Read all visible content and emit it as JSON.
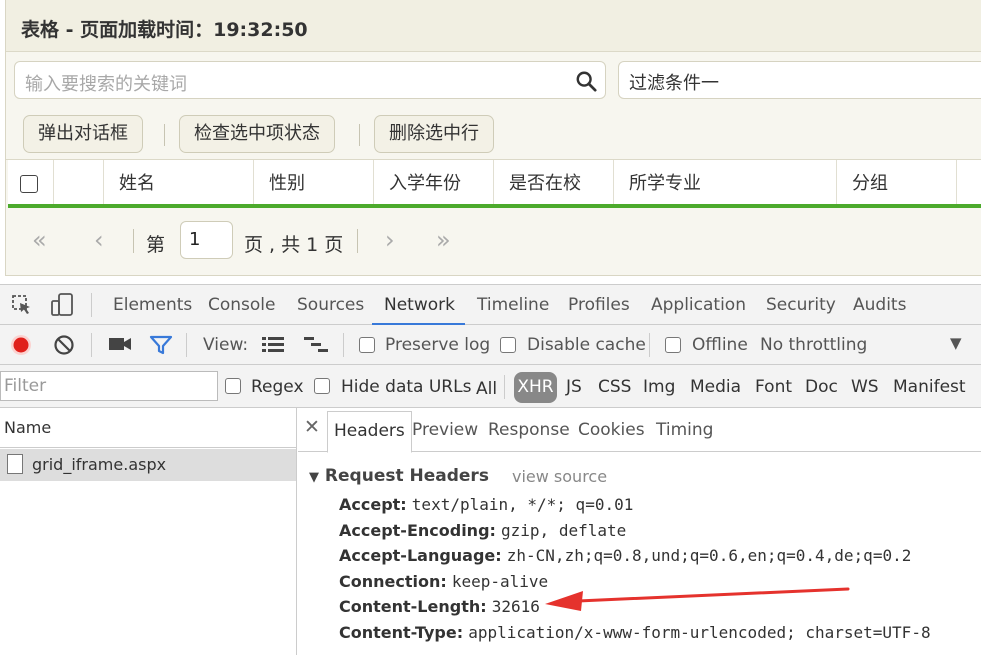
{
  "page": {
    "title": "表格 - 页面加载时间：19:32:50",
    "search": {
      "placeholder": "输入要搜索的关键词"
    },
    "filter": {
      "value": "过滤条件一"
    },
    "toolbar": {
      "btn_dialog": "弹出对话框",
      "btn_check": "检查选中项状态",
      "btn_delete": "删除选中行"
    },
    "grid": {
      "columns": [
        "姓名",
        "性别",
        "入学年份",
        "是否在校",
        "所学专业",
        "分组"
      ]
    },
    "pager": {
      "label_page": "第",
      "current_page": "1",
      "label_total": "页 , 共 1 页"
    }
  },
  "devtools": {
    "tabs": [
      "Elements",
      "Console",
      "Sources",
      "Network",
      "Timeline",
      "Profiles",
      "Application",
      "Security",
      "Audits"
    ],
    "active_tab": "Network",
    "controls": {
      "view_label": "View:",
      "preserve_log": "Preserve log",
      "disable_cache": "Disable cache",
      "offline": "Offline",
      "throttling": "No throttling"
    },
    "filter_bar": {
      "placeholder": "Filter",
      "regex": "Regex",
      "hide_data_urls": "Hide data URLs",
      "types": [
        "All",
        "XHR",
        "JS",
        "CSS",
        "Img",
        "Media",
        "Font",
        "Doc",
        "WS",
        "Manifest"
      ],
      "active_type": "XHR"
    },
    "requests": {
      "column_name": "Name",
      "items": [
        "grid_iframe.aspx"
      ]
    },
    "detail": {
      "tabs": [
        "Headers",
        "Preview",
        "Response",
        "Cookies",
        "Timing"
      ],
      "active_tab": "Headers",
      "section_title": "Request Headers",
      "view_source": "view source",
      "headers": [
        {
          "key": "Accept:",
          "value": "text/plain, */*; q=0.01"
        },
        {
          "key": "Accept-Encoding:",
          "value": "gzip, deflate"
        },
        {
          "key": "Accept-Language:",
          "value": "zh-CN,zh;q=0.8,und;q=0.6,en;q=0.4,de;q=0.2"
        },
        {
          "key": "Connection:",
          "value": "keep-alive"
        },
        {
          "key": "Content-Length:",
          "value": "32616"
        },
        {
          "key": "Content-Type:",
          "value": "application/x-www-form-urlencoded; charset=UTF-8"
        }
      ]
    }
  },
  "colors": {
    "grid_accent": "#4caa2c",
    "record_red": "#e0201b",
    "filter_blue": "#3879d9",
    "annotation_arrow": "#e5322d"
  }
}
